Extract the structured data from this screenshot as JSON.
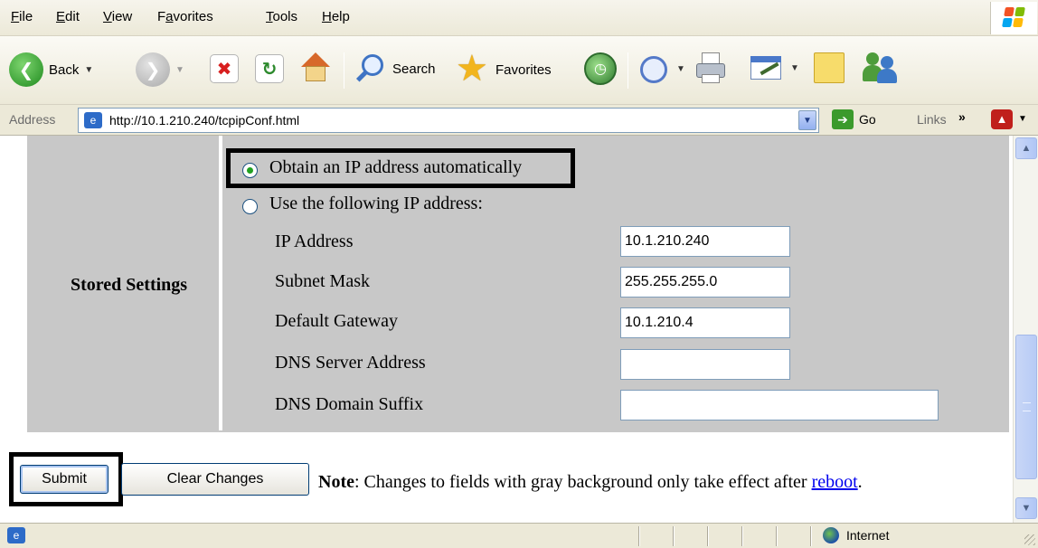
{
  "menu": {
    "items": [
      "File",
      "Edit",
      "View",
      "Favorites",
      "Tools",
      "Help"
    ],
    "underlined": [
      "F",
      "E",
      "V",
      "a",
      "T",
      "H"
    ],
    "rest": [
      "ile",
      "dit",
      "iew",
      "vorites",
      "ools",
      "elp"
    ],
    "prefix": [
      "",
      "",
      "",
      "F",
      "",
      ""
    ]
  },
  "toolbar": {
    "back_label": "Back",
    "search_label": "Search",
    "favorites_label": "Favorites"
  },
  "address": {
    "label": "Address",
    "url": "http://10.1.210.240/tcpipConf.html",
    "go_label": "Go",
    "links_label": "Links"
  },
  "form": {
    "section_label": "Stored Settings",
    "radio_auto_label": "Obtain an IP address automatically",
    "radio_manual_label": "Use the following IP address:",
    "auto_selected": true,
    "fields": [
      {
        "label": "IP Address",
        "value": "10.1.210.240"
      },
      {
        "label": "Subnet Mask",
        "value": "255.255.255.0"
      },
      {
        "label": "Default Gateway",
        "value": "10.1.210.4"
      },
      {
        "label": "DNS Server Address",
        "value": ""
      },
      {
        "label": "DNS Domain Suffix",
        "value": ""
      }
    ],
    "submit_label": "Submit",
    "clear_label": "Clear Changes",
    "note_bold": "Note",
    "note_text": ": Changes to fields with gray background only take effect after ",
    "note_link": "reboot",
    "note_end": "."
  },
  "status": {
    "zone_label": "Internet"
  },
  "colors": {
    "table_bg": "#c8c8c8",
    "link": "#0000ee",
    "radio_dot": "#21a121",
    "highlight_border": "#000000"
  }
}
